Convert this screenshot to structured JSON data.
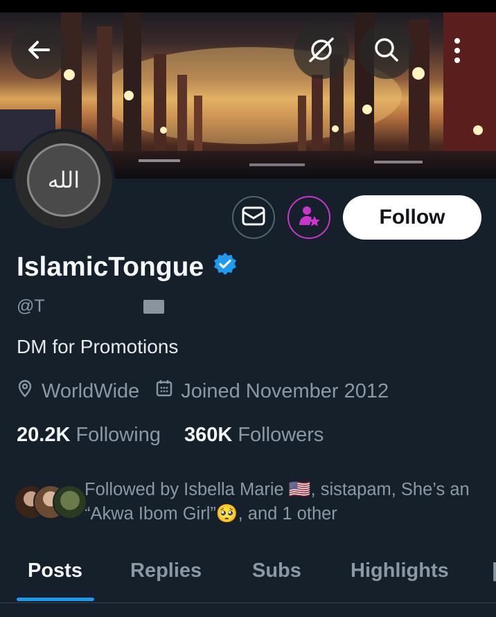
{
  "profile": {
    "display_name": "IslamicTongue",
    "handle": "@T",
    "bio": "DM for Promotions",
    "location": "WorldWide",
    "joined": "Joined November 2012",
    "avatar_text": "الله"
  },
  "stats": {
    "following_count": "20.2K",
    "following_label": "Following",
    "followers_count": "360K",
    "followers_label": "Followers"
  },
  "followed_by": {
    "text": "Followed by Isbella Marie 🇺🇸, sistapam, She’s an “Akwa Ibom Girl”🥺, and 1 other"
  },
  "actions": {
    "follow_label": "Follow"
  },
  "tabs": [
    {
      "label": "Posts",
      "active": true
    },
    {
      "label": "Replies",
      "active": false
    },
    {
      "label": "Subs",
      "active": false
    },
    {
      "label": "Highlights",
      "active": false
    }
  ],
  "icons": {
    "back": "back-arrow-icon",
    "grok": "grok-icon",
    "search": "search-icon",
    "more": "more-vertical-icon",
    "message": "message-envelope-icon",
    "subscribe": "subscribe-star-person-icon",
    "verified": "verified-badge-icon",
    "location": "location-pin-icon",
    "calendar": "calendar-icon"
  },
  "colors": {
    "background": "#15202b",
    "accent": "#1d9bf0",
    "verified": "#1d9bf0",
    "subscribe": "#c936cc",
    "muted_text": "#8b98a5"
  }
}
